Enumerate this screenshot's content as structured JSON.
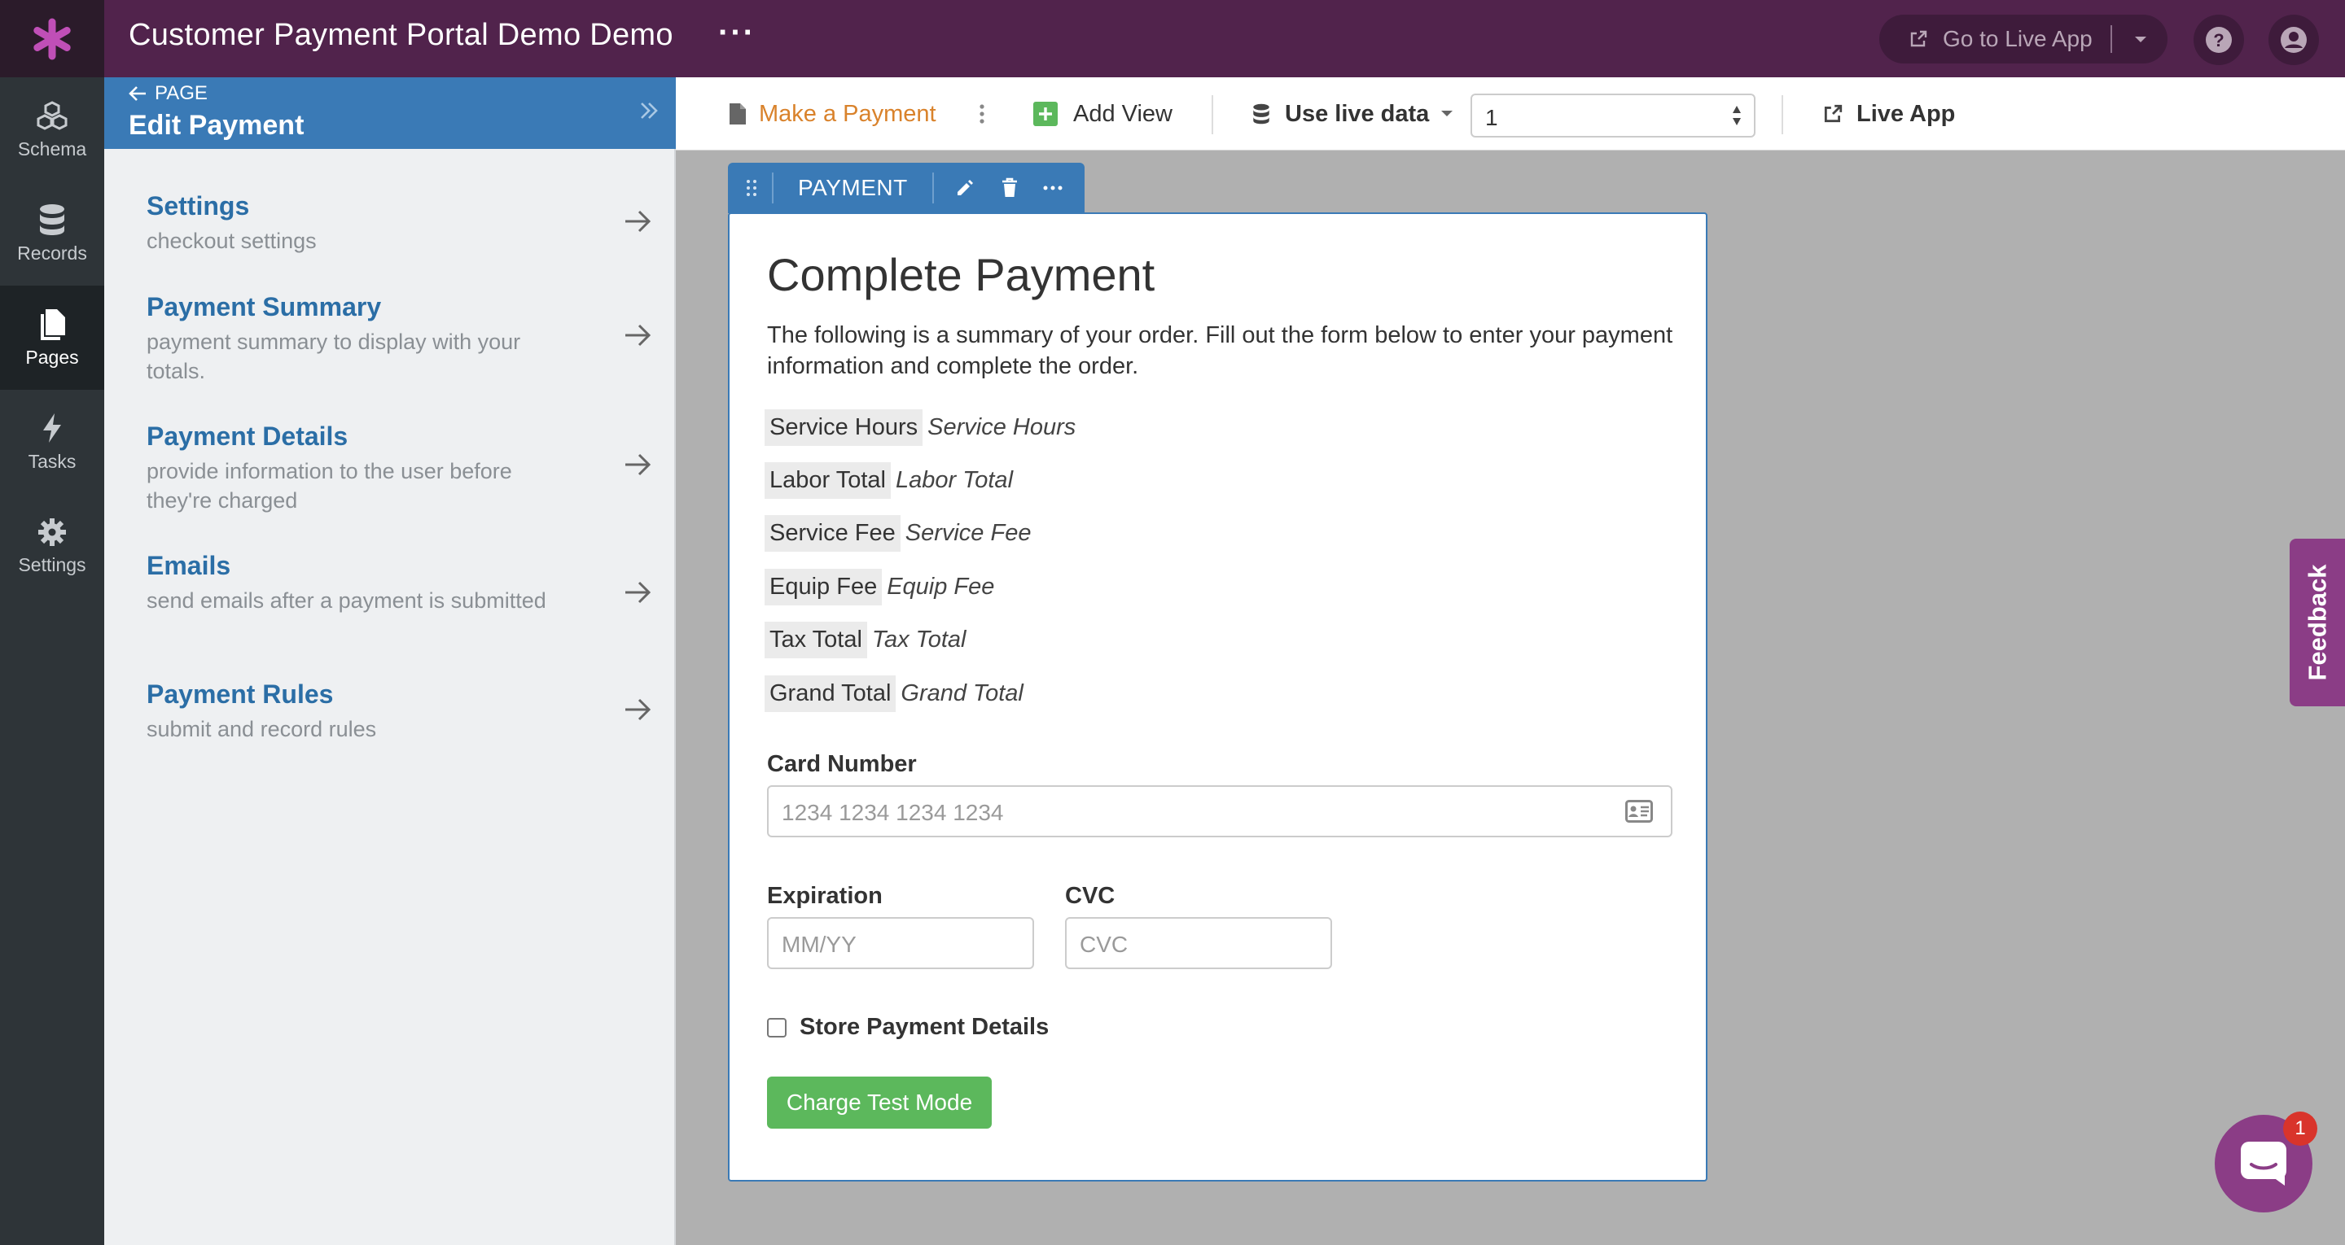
{
  "header": {
    "app_title": "Customer Payment Portal Demo Demo",
    "more_label": "···",
    "go_live_label": "Go to Live App"
  },
  "rail": {
    "items": [
      {
        "label": "Schema",
        "icon": "schema-icon"
      },
      {
        "label": "Records",
        "icon": "database-icon"
      },
      {
        "label": "Pages",
        "icon": "pages-icon"
      },
      {
        "label": "Tasks",
        "icon": "bolt-icon"
      },
      {
        "label": "Settings",
        "icon": "gear-icon"
      }
    ]
  },
  "side": {
    "back_label": "PAGE",
    "title": "Edit Payment",
    "items": [
      {
        "title": "Settings",
        "desc": "checkout settings"
      },
      {
        "title": "Payment Summary",
        "desc": "payment summary to display with your totals."
      },
      {
        "title": "Payment Details",
        "desc": "provide information to the user before they're charged"
      },
      {
        "title": "Emails",
        "desc": "send emails after a payment is submitted"
      },
      {
        "title": "Payment Rules",
        "desc": "submit and record rules"
      }
    ]
  },
  "toolbar": {
    "page_name": "Make a Payment",
    "add_view": "Add View",
    "live_data": "Use live data",
    "record_value": "1",
    "live_app": "Live App"
  },
  "view": {
    "tab_label": "PAYMENT",
    "title": "Complete Payment",
    "intro": "The following is a summary of your order. Fill out the form below to enter your payment information and complete the order.",
    "summary": [
      {
        "label": "Service Hours",
        "value": "Service Hours"
      },
      {
        "label": "Labor Total",
        "value": "Labor Total"
      },
      {
        "label": "Service Fee",
        "value": "Service Fee"
      },
      {
        "label": "Equip Fee",
        "value": "Equip Fee"
      },
      {
        "label": "Tax Total",
        "value": "Tax Total"
      },
      {
        "label": "Grand Total",
        "value": "Grand Total"
      }
    ],
    "card_number_label": "Card Number",
    "card_number_placeholder": "1234 1234 1234 1234",
    "expiration_label": "Expiration",
    "expiration_placeholder": "MM/YY",
    "cvc_label": "CVC",
    "cvc_placeholder": "CVC",
    "store_label": "Store Payment Details",
    "charge_button": "Charge Test Mode"
  },
  "feedback_label": "Feedback",
  "chat_badge": "1",
  "colors": {
    "header_bg": "#51234c",
    "rail_bg": "#2e3438",
    "accent_blue": "#3a7ab6",
    "page_name_orange": "#d9822b",
    "button_green": "#5cb85c",
    "feedback_purple": "#8b3d86"
  }
}
